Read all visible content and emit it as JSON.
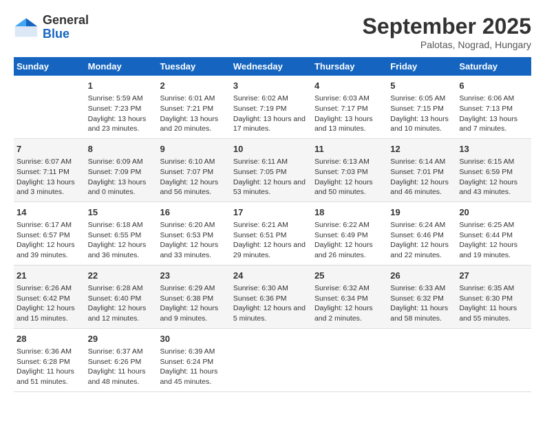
{
  "header": {
    "logo_general": "General",
    "logo_blue": "Blue",
    "month_title": "September 2025",
    "location": "Palotas, Nograd, Hungary"
  },
  "days_of_week": [
    "Sunday",
    "Monday",
    "Tuesday",
    "Wednesday",
    "Thursday",
    "Friday",
    "Saturday"
  ],
  "weeks": [
    [
      {
        "num": "",
        "sunrise": "",
        "sunset": "",
        "daylight": ""
      },
      {
        "num": "1",
        "sunrise": "Sunrise: 5:59 AM",
        "sunset": "Sunset: 7:23 PM",
        "daylight": "Daylight: 13 hours and 23 minutes."
      },
      {
        "num": "2",
        "sunrise": "Sunrise: 6:01 AM",
        "sunset": "Sunset: 7:21 PM",
        "daylight": "Daylight: 13 hours and 20 minutes."
      },
      {
        "num": "3",
        "sunrise": "Sunrise: 6:02 AM",
        "sunset": "Sunset: 7:19 PM",
        "daylight": "Daylight: 13 hours and 17 minutes."
      },
      {
        "num": "4",
        "sunrise": "Sunrise: 6:03 AM",
        "sunset": "Sunset: 7:17 PM",
        "daylight": "Daylight: 13 hours and 13 minutes."
      },
      {
        "num": "5",
        "sunrise": "Sunrise: 6:05 AM",
        "sunset": "Sunset: 7:15 PM",
        "daylight": "Daylight: 13 hours and 10 minutes."
      },
      {
        "num": "6",
        "sunrise": "Sunrise: 6:06 AM",
        "sunset": "Sunset: 7:13 PM",
        "daylight": "Daylight: 13 hours and 7 minutes."
      }
    ],
    [
      {
        "num": "7",
        "sunrise": "Sunrise: 6:07 AM",
        "sunset": "Sunset: 7:11 PM",
        "daylight": "Daylight: 13 hours and 3 minutes."
      },
      {
        "num": "8",
        "sunrise": "Sunrise: 6:09 AM",
        "sunset": "Sunset: 7:09 PM",
        "daylight": "Daylight: 13 hours and 0 minutes."
      },
      {
        "num": "9",
        "sunrise": "Sunrise: 6:10 AM",
        "sunset": "Sunset: 7:07 PM",
        "daylight": "Daylight: 12 hours and 56 minutes."
      },
      {
        "num": "10",
        "sunrise": "Sunrise: 6:11 AM",
        "sunset": "Sunset: 7:05 PM",
        "daylight": "Daylight: 12 hours and 53 minutes."
      },
      {
        "num": "11",
        "sunrise": "Sunrise: 6:13 AM",
        "sunset": "Sunset: 7:03 PM",
        "daylight": "Daylight: 12 hours and 50 minutes."
      },
      {
        "num": "12",
        "sunrise": "Sunrise: 6:14 AM",
        "sunset": "Sunset: 7:01 PM",
        "daylight": "Daylight: 12 hours and 46 minutes."
      },
      {
        "num": "13",
        "sunrise": "Sunrise: 6:15 AM",
        "sunset": "Sunset: 6:59 PM",
        "daylight": "Daylight: 12 hours and 43 minutes."
      }
    ],
    [
      {
        "num": "14",
        "sunrise": "Sunrise: 6:17 AM",
        "sunset": "Sunset: 6:57 PM",
        "daylight": "Daylight: 12 hours and 39 minutes."
      },
      {
        "num": "15",
        "sunrise": "Sunrise: 6:18 AM",
        "sunset": "Sunset: 6:55 PM",
        "daylight": "Daylight: 12 hours and 36 minutes."
      },
      {
        "num": "16",
        "sunrise": "Sunrise: 6:20 AM",
        "sunset": "Sunset: 6:53 PM",
        "daylight": "Daylight: 12 hours and 33 minutes."
      },
      {
        "num": "17",
        "sunrise": "Sunrise: 6:21 AM",
        "sunset": "Sunset: 6:51 PM",
        "daylight": "Daylight: 12 hours and 29 minutes."
      },
      {
        "num": "18",
        "sunrise": "Sunrise: 6:22 AM",
        "sunset": "Sunset: 6:49 PM",
        "daylight": "Daylight: 12 hours and 26 minutes."
      },
      {
        "num": "19",
        "sunrise": "Sunrise: 6:24 AM",
        "sunset": "Sunset: 6:46 PM",
        "daylight": "Daylight: 12 hours and 22 minutes."
      },
      {
        "num": "20",
        "sunrise": "Sunrise: 6:25 AM",
        "sunset": "Sunset: 6:44 PM",
        "daylight": "Daylight: 12 hours and 19 minutes."
      }
    ],
    [
      {
        "num": "21",
        "sunrise": "Sunrise: 6:26 AM",
        "sunset": "Sunset: 6:42 PM",
        "daylight": "Daylight: 12 hours and 15 minutes."
      },
      {
        "num": "22",
        "sunrise": "Sunrise: 6:28 AM",
        "sunset": "Sunset: 6:40 PM",
        "daylight": "Daylight: 12 hours and 12 minutes."
      },
      {
        "num": "23",
        "sunrise": "Sunrise: 6:29 AM",
        "sunset": "Sunset: 6:38 PM",
        "daylight": "Daylight: 12 hours and 9 minutes."
      },
      {
        "num": "24",
        "sunrise": "Sunrise: 6:30 AM",
        "sunset": "Sunset: 6:36 PM",
        "daylight": "Daylight: 12 hours and 5 minutes."
      },
      {
        "num": "25",
        "sunrise": "Sunrise: 6:32 AM",
        "sunset": "Sunset: 6:34 PM",
        "daylight": "Daylight: 12 hours and 2 minutes."
      },
      {
        "num": "26",
        "sunrise": "Sunrise: 6:33 AM",
        "sunset": "Sunset: 6:32 PM",
        "daylight": "Daylight: 11 hours and 58 minutes."
      },
      {
        "num": "27",
        "sunrise": "Sunrise: 6:35 AM",
        "sunset": "Sunset: 6:30 PM",
        "daylight": "Daylight: 11 hours and 55 minutes."
      }
    ],
    [
      {
        "num": "28",
        "sunrise": "Sunrise: 6:36 AM",
        "sunset": "Sunset: 6:28 PM",
        "daylight": "Daylight: 11 hours and 51 minutes."
      },
      {
        "num": "29",
        "sunrise": "Sunrise: 6:37 AM",
        "sunset": "Sunset: 6:26 PM",
        "daylight": "Daylight: 11 hours and 48 minutes."
      },
      {
        "num": "30",
        "sunrise": "Sunrise: 6:39 AM",
        "sunset": "Sunset: 6:24 PM",
        "daylight": "Daylight: 11 hours and 45 minutes."
      },
      {
        "num": "",
        "sunrise": "",
        "sunset": "",
        "daylight": ""
      },
      {
        "num": "",
        "sunrise": "",
        "sunset": "",
        "daylight": ""
      },
      {
        "num": "",
        "sunrise": "",
        "sunset": "",
        "daylight": ""
      },
      {
        "num": "",
        "sunrise": "",
        "sunset": "",
        "daylight": ""
      }
    ]
  ]
}
